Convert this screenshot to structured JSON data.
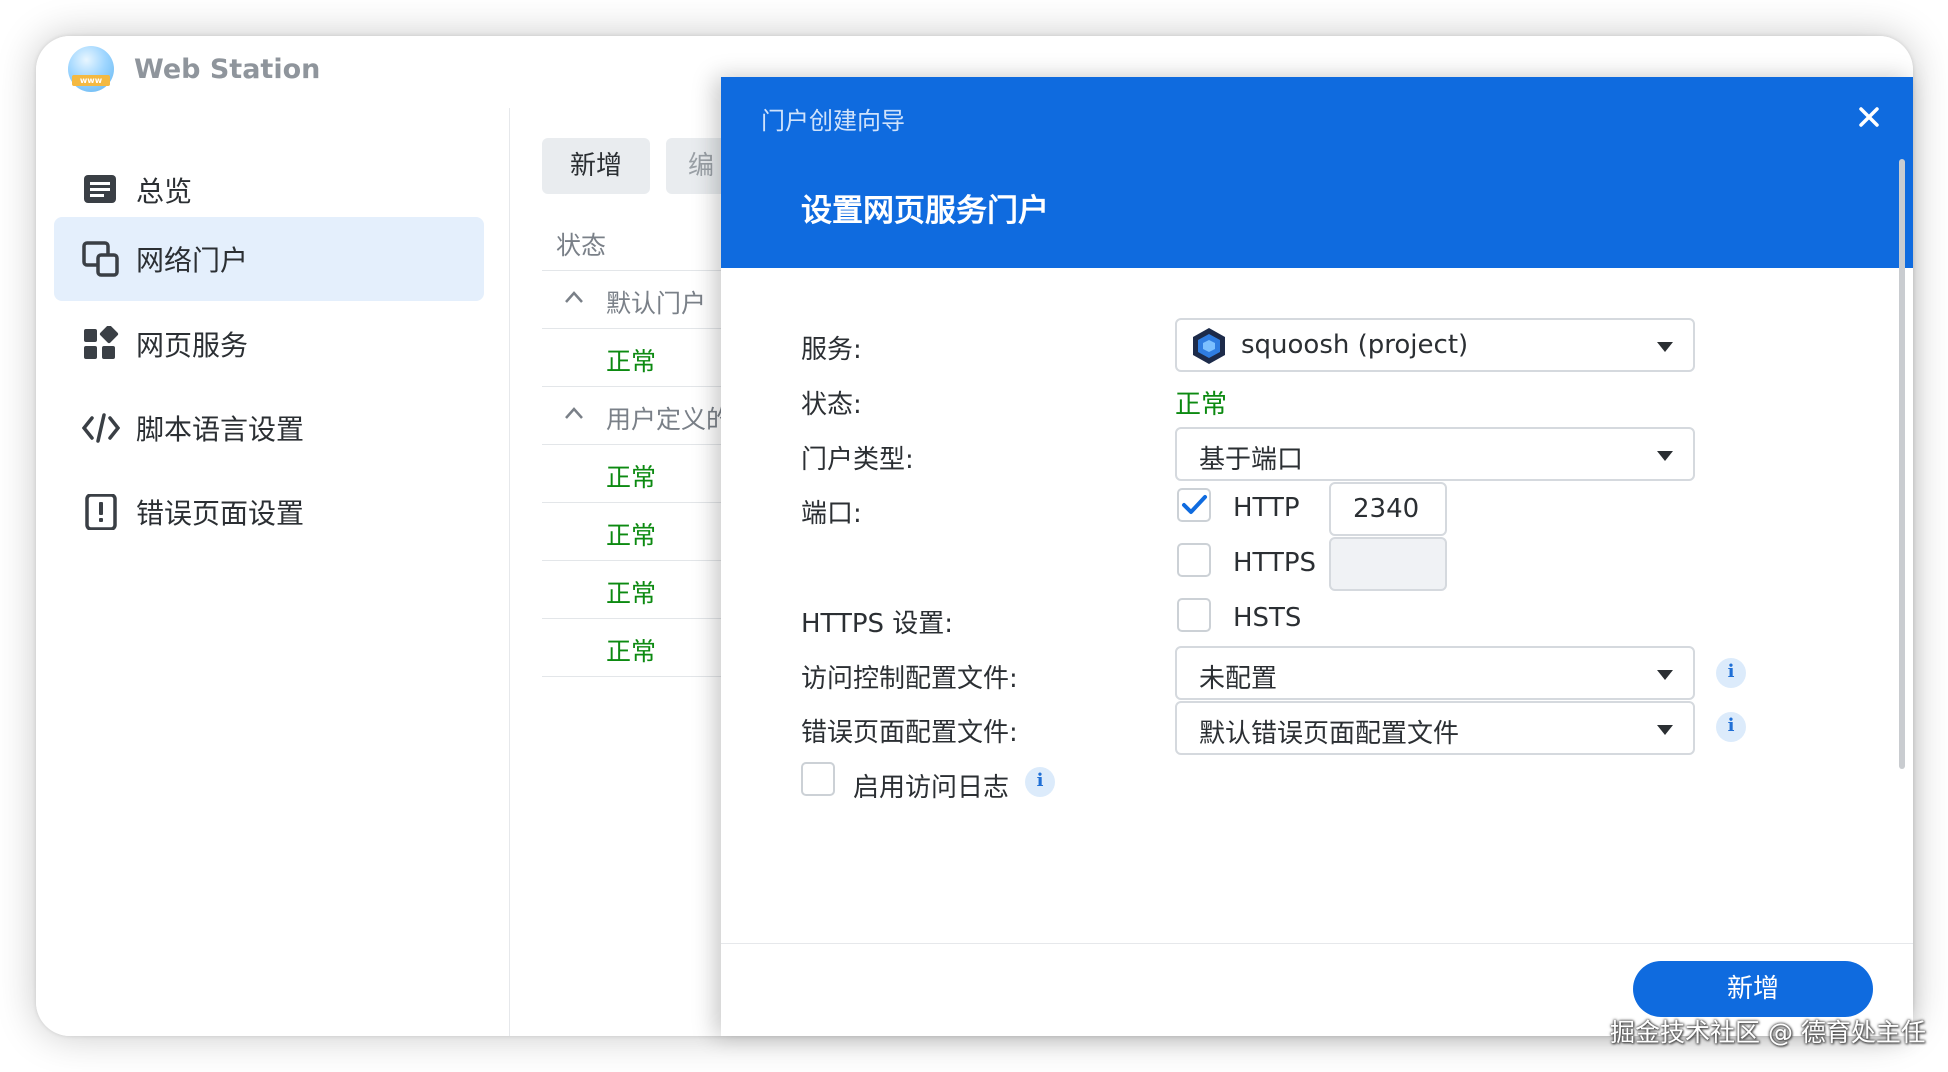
{
  "app": {
    "title": "Web Station"
  },
  "sidebar": {
    "items": [
      {
        "label": "总览",
        "icon": "overview-icon",
        "active": false
      },
      {
        "label": "网络门户",
        "icon": "portal-icon",
        "active": true
      },
      {
        "label": "网页服务",
        "icon": "grid-icon",
        "active": false
      },
      {
        "label": "脚本语言设置",
        "icon": "code-icon",
        "active": false
      },
      {
        "label": "错误页面设置",
        "icon": "error-page-icon",
        "active": false
      }
    ]
  },
  "toolbar": {
    "add_label": "新增",
    "edit_label": "编"
  },
  "table": {
    "header": "状态",
    "groups": [
      {
        "label": "默认门户",
        "rows": [
          "正常"
        ]
      },
      {
        "label": "用户定义的",
        "rows": [
          "正常",
          "正常",
          "正常",
          "正常"
        ]
      }
    ]
  },
  "dialog": {
    "wizard_title": "门户创建向导",
    "title": "设置网页服务门户",
    "fields": {
      "service_label": "服务:",
      "service_value": "squoosh (project)",
      "status_label": "状态:",
      "status_value": "正常",
      "portal_type_label": "门户类型:",
      "portal_type_value": "基于端口",
      "port_label": "端口:",
      "http_label": "HTTP",
      "http_checked": true,
      "http_port": "2340",
      "https_label": "HTTPS",
      "https_checked": false,
      "https_port": "",
      "https_settings_label": "HTTPS 设置:",
      "hsts_label": "HSTS",
      "hsts_checked": false,
      "access_profile_label": "访问控制配置文件:",
      "access_profile_value": "未配置",
      "error_profile_label": "错误页面配置文件:",
      "error_profile_value": "默认错误页面配置文件",
      "access_log_label": "启用访问日志",
      "access_log_checked": false
    },
    "submit_label": "新增"
  },
  "colors": {
    "accent": "#0f6bdf",
    "status_ok": "#0c8a11",
    "active_nav": "#e4effc"
  },
  "watermark": "掘金技术社区 @ 德育处主任"
}
